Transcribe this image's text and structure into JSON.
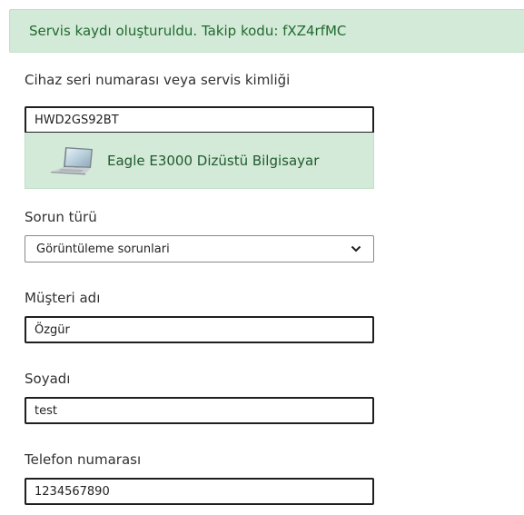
{
  "alert": {
    "message": "Servis kaydı oluşturuldu. Takip kodu: fXZ4rfMC"
  },
  "serial": {
    "label": "Cihaz seri numarası veya servis kimliği",
    "value": "HWD2GS92BT",
    "device_name": "Eagle E3000 Dizüstü Bilgisayar",
    "device_icon": "laptop-icon"
  },
  "issue_type": {
    "label": "Sorun türü",
    "selected": "Görüntüleme sorunlari",
    "chevron_icon": "chevron-down-icon"
  },
  "customer_name": {
    "label": "Müşteri adı",
    "value": "Özgür"
  },
  "surname": {
    "label": "Soyadı",
    "value": "test"
  },
  "phone": {
    "label": "Telefon numarası",
    "value": "1234567890"
  },
  "colors": {
    "success_bg": "#d4ead9",
    "success_text": "#1f6a2c",
    "field_border": "#201f1e"
  }
}
